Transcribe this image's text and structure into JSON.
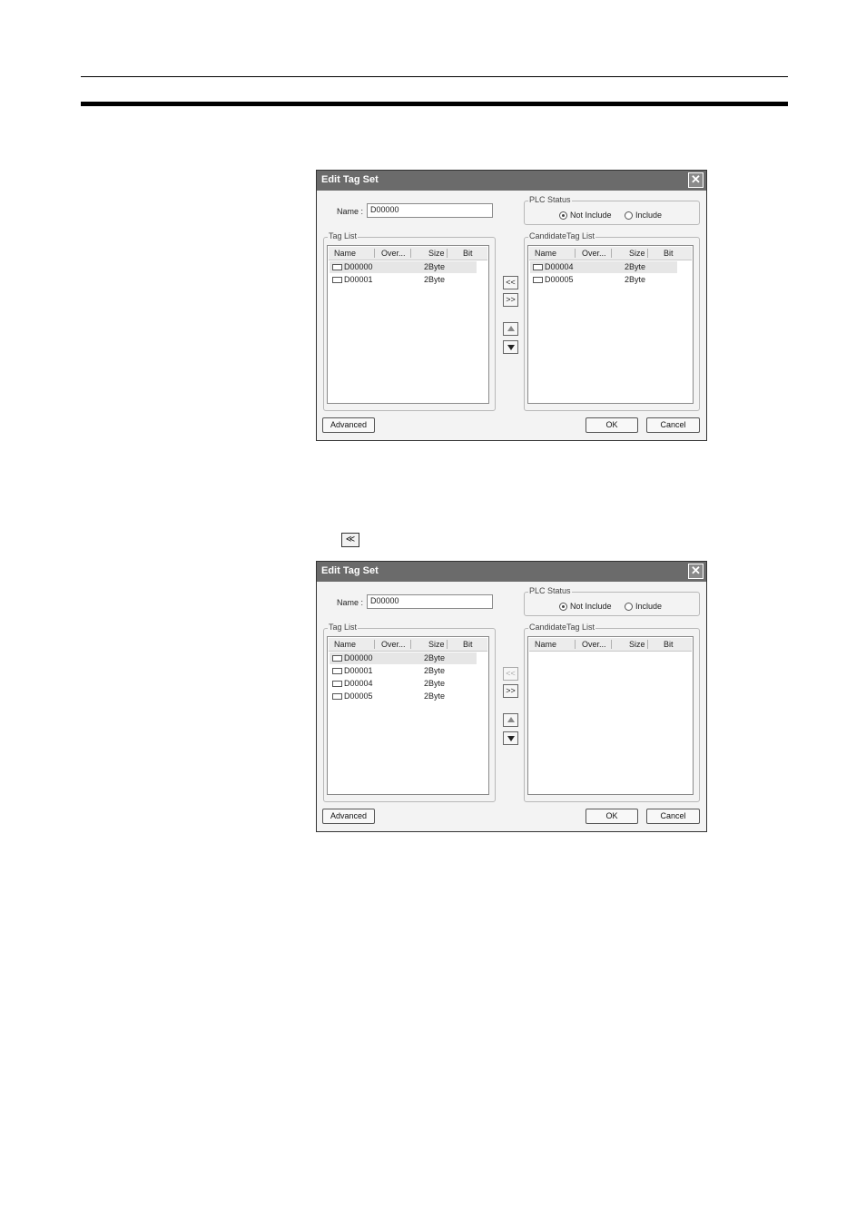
{
  "inline_icon": {
    "label": "≪",
    "name": "add-to-tag-list-icon"
  },
  "dialogs": [
    {
      "title": "Edit Tag Set",
      "name_label": "Name :",
      "name_value": "D00000",
      "plc_status": {
        "label": "PLC Status",
        "options": [
          "Not Include",
          "Include"
        ],
        "selected": "Not Include"
      },
      "tag_list": {
        "title": "Tag List",
        "columns": [
          "Name",
          "Over...",
          "Size",
          "Bit"
        ],
        "rows": [
          {
            "name": "D00000",
            "size": "2Byte"
          },
          {
            "name": "D00001",
            "size": "2Byte"
          }
        ]
      },
      "candidate_list": {
        "title": "CandidateTag List",
        "columns": [
          "Name",
          "Over...",
          "Size",
          "Bit"
        ],
        "rows": [
          {
            "name": "D00004",
            "size": "2Byte"
          },
          {
            "name": "D00005",
            "size": "2Byte"
          }
        ]
      },
      "move_buttons": {
        "add": "<<",
        "remove": ">>",
        "add_enabled": true
      },
      "buttons": {
        "advanced": "Advanced",
        "ok": "OK",
        "cancel": "Cancel"
      },
      "close_glyph": "✕"
    },
    {
      "title": "Edit Tag Set",
      "name_label": "Name :",
      "name_value": "D00000",
      "plc_status": {
        "label": "PLC Status",
        "options": [
          "Not Include",
          "Include"
        ],
        "selected": "Not Include"
      },
      "tag_list": {
        "title": "Tag List",
        "columns": [
          "Name",
          "Over...",
          "Size",
          "Bit"
        ],
        "rows": [
          {
            "name": "D00000",
            "size": "2Byte"
          },
          {
            "name": "D00001",
            "size": "2Byte"
          },
          {
            "name": "D00004",
            "size": "2Byte"
          },
          {
            "name": "D00005",
            "size": "2Byte"
          }
        ]
      },
      "candidate_list": {
        "title": "CandidateTag List",
        "columns": [
          "Name",
          "Over...",
          "Size",
          "Bit"
        ],
        "rows": []
      },
      "move_buttons": {
        "add": "<<",
        "remove": ">>",
        "add_enabled": false
      },
      "buttons": {
        "advanced": "Advanced",
        "ok": "OK",
        "cancel": "Cancel"
      },
      "close_glyph": "✕"
    }
  ]
}
